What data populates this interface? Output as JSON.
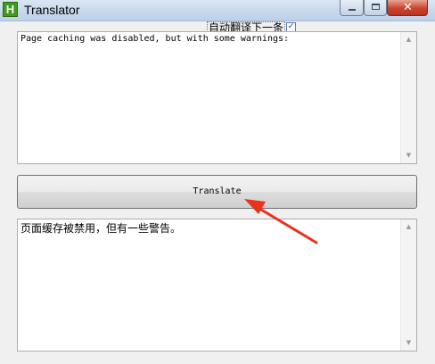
{
  "window": {
    "title": "Translator",
    "app_icon_letter": "H",
    "controls": {
      "minimize_icon": "minimize-icon",
      "maximize_icon": "maximize-icon",
      "close_icon": "close-icon",
      "close_glyph": "✕"
    }
  },
  "auto_translate": {
    "label": "自动翻译下一条",
    "checked": true,
    "check_glyph": "✓"
  },
  "source_text": {
    "value": "Page caching was disabled, but with some warnings:"
  },
  "translate_button": {
    "label": "Translate"
  },
  "result_text": {
    "value": "页面缓存被禁用，但有一些警告。"
  },
  "scroll": {
    "up_glyph": "▲",
    "down_glyph": "▼"
  },
  "colors": {
    "annotation_arrow": "#e8321e",
    "app_icon": "#3f9a1e"
  }
}
